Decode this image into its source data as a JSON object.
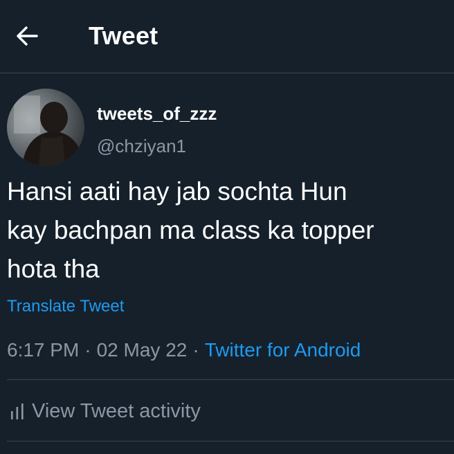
{
  "header": {
    "title": "Tweet",
    "back_icon": "arrow-left-icon"
  },
  "author": {
    "display_name": "tweets_of_zzz",
    "handle": "@chziyan1"
  },
  "tweet": {
    "text": "Hansi aati hay jab sochta Hun\nkay bachpan ma class ka topper\nhota tha",
    "translate_label": "Translate Tweet",
    "time": "6:17 PM",
    "date": "02 May 22",
    "source": "Twitter for Android"
  },
  "activity": {
    "label": "View Tweet activity",
    "icon": "bar-chart-icon"
  },
  "colors": {
    "background": "#15202b",
    "divider": "#38444d",
    "secondary_text": "#8b98a5",
    "link": "#1d9bf0"
  }
}
